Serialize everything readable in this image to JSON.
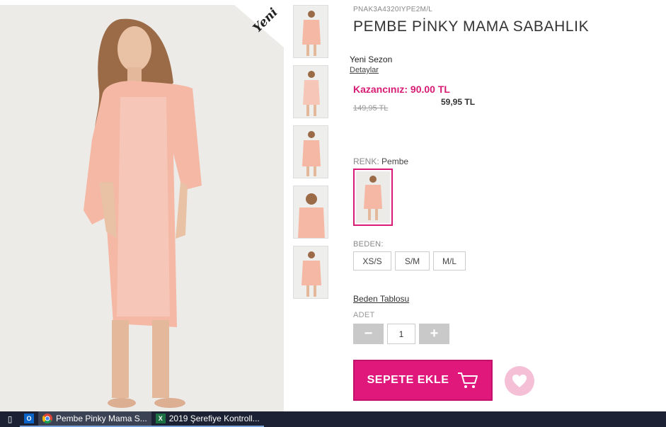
{
  "product": {
    "sku": "PNAK3A4320IYPE2M/L",
    "title": "PEMBE PİNKY MAMA SABAHLIK",
    "badge": "Yeni",
    "season": "Yeni Sezon",
    "details_link": "Detaylar",
    "savings": "Kazancınız: 90.00 TL",
    "old_price": "149,95 TL",
    "new_price": "59,95 TL"
  },
  "color": {
    "label": "RENK:",
    "value": "Pembe",
    "accent": "#d81b74"
  },
  "size": {
    "label": "BEDEN:",
    "options": [
      "XS/S",
      "S/M",
      "M/L"
    ]
  },
  "size_table_link": "Beden Tablosu",
  "quantity": {
    "label": "ADET",
    "value": "1",
    "minus": "−",
    "plus": "+"
  },
  "cart": {
    "label": "SEPETE EKLE",
    "color": "#e0187c"
  },
  "taskbar": {
    "apps": [
      {
        "icon": "outlook-icon",
        "label": ""
      },
      {
        "icon": "chrome-icon",
        "label": "Pembe Pinky Mama S..."
      },
      {
        "icon": "excel-icon",
        "label": "2019 Şerefiye Kontroll..."
      }
    ]
  }
}
